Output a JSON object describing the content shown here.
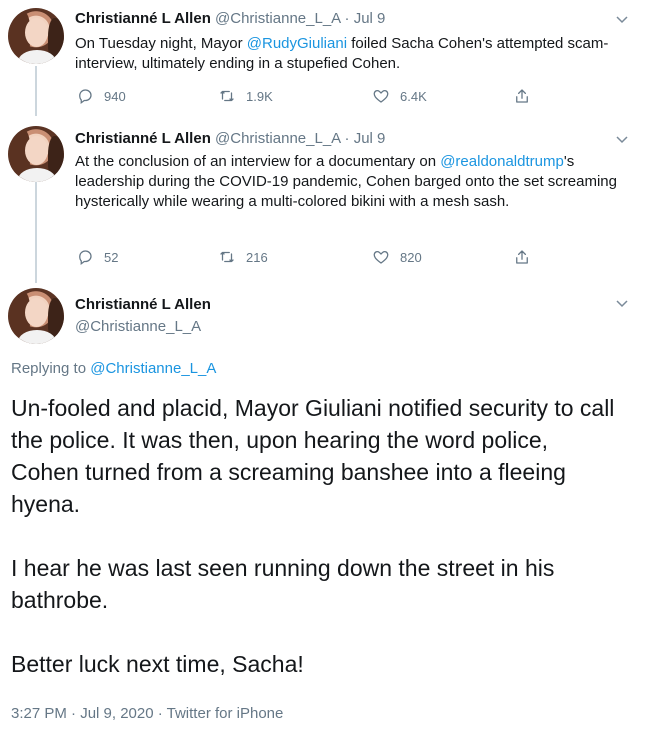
{
  "tweets": [
    {
      "name": "Christianné L Allen",
      "handle": "@Christianne_L_A",
      "separator": "·",
      "date": "Jul 9",
      "text_before": "On Tuesday night, Mayor ",
      "mention": "@RudyGiuliani",
      "text_after": " foiled Sacha Cohen's attempted scam-interview, ultimately ending in a stupefied Cohen.",
      "reply_count": "940",
      "retweet_count": "1.9K",
      "like_count": "6.4K"
    },
    {
      "name": "Christianné L Allen",
      "handle": "@Christianne_L_A",
      "separator": "·",
      "date": "Jul 9",
      "text_before": "At the conclusion of an interview for a documentary on ",
      "mention": "@realdonaldtrump",
      "text_after": "'s leadership during the COVID-19 pandemic, Cohen barged onto the set screaming hysterically while wearing a multi-colored bikini with a mesh sash.",
      "reply_count": "52",
      "retweet_count": "216",
      "like_count": "820"
    }
  ],
  "main_tweet": {
    "name": "Christianné L Allen",
    "handle": "@Christianne_L_A",
    "replying_prefix": "Replying to ",
    "replying_to": "@Christianne_L_A",
    "text": "Un-fooled and placid, Mayor Giuliani notified security to call the police. It was then, upon hearing the word police, Cohen turned from a screaming banshee into a fleeing hyena.\n\nI hear he was last seen running down the street in his bathrobe.\n\nBetter luck next time, Sacha!",
    "timestamp": "3:27 PM · Jul 9, 2020 · Twitter for iPhone"
  },
  "icons": {
    "reply": "reply-icon",
    "retweet": "retweet-icon",
    "like": "heart-icon",
    "share": "share-icon",
    "menu": "chevron-down-icon"
  },
  "colors": {
    "link": "#1b95e0",
    "secondary_text": "#657786",
    "primary_text": "#14171a",
    "thread_line": "#ccd6dd"
  }
}
